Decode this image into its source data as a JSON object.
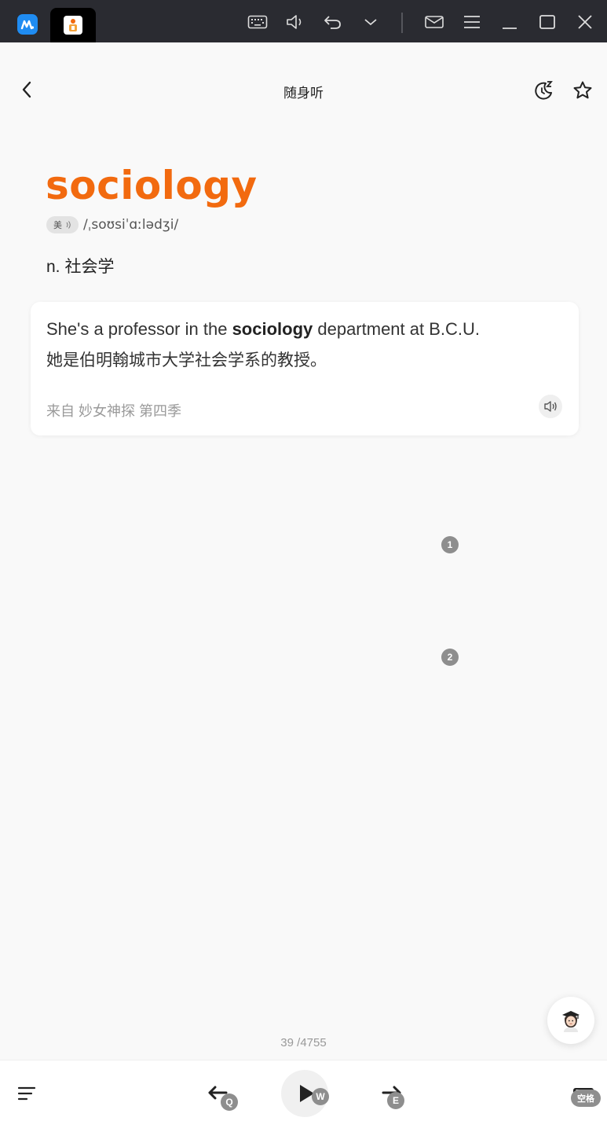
{
  "topbar": {
    "icons": [
      "app-logo-icon",
      "keyboard-icon",
      "volume-icon",
      "undo-icon",
      "chevron-down-icon",
      "mail-icon",
      "menu-icon",
      "minimize-icon",
      "maximize-icon",
      "close-icon"
    ]
  },
  "header": {
    "title": "随身听",
    "back_icon": "chevron-left-icon",
    "sleep_timer_icon": "moon-z-icon",
    "favorite_icon": "star-icon"
  },
  "word": {
    "text": "sociology",
    "pron_region": "美",
    "phonetic": "/ˌsoʊsiˈɑːlədʒi/",
    "pos": "n.",
    "meaning": "社会学"
  },
  "example": {
    "en_before": "She's a professor in the ",
    "en_highlight": "sociology",
    "en_after": " department at B.C.U.",
    "cn": "她是伯明翰城市大学社会学系的教授。",
    "source": "来自 妙女神探 第四季"
  },
  "markers": [
    "1",
    "2"
  ],
  "counter": "39 /4755",
  "bottom": {
    "prev_key": "Q",
    "play_key": "W",
    "next_key": "E",
    "space_key": "空格"
  },
  "colors": {
    "accent": "#f26a0f",
    "topbar_bg": "#2a2b31",
    "page_bg": "#f9f9f9"
  }
}
